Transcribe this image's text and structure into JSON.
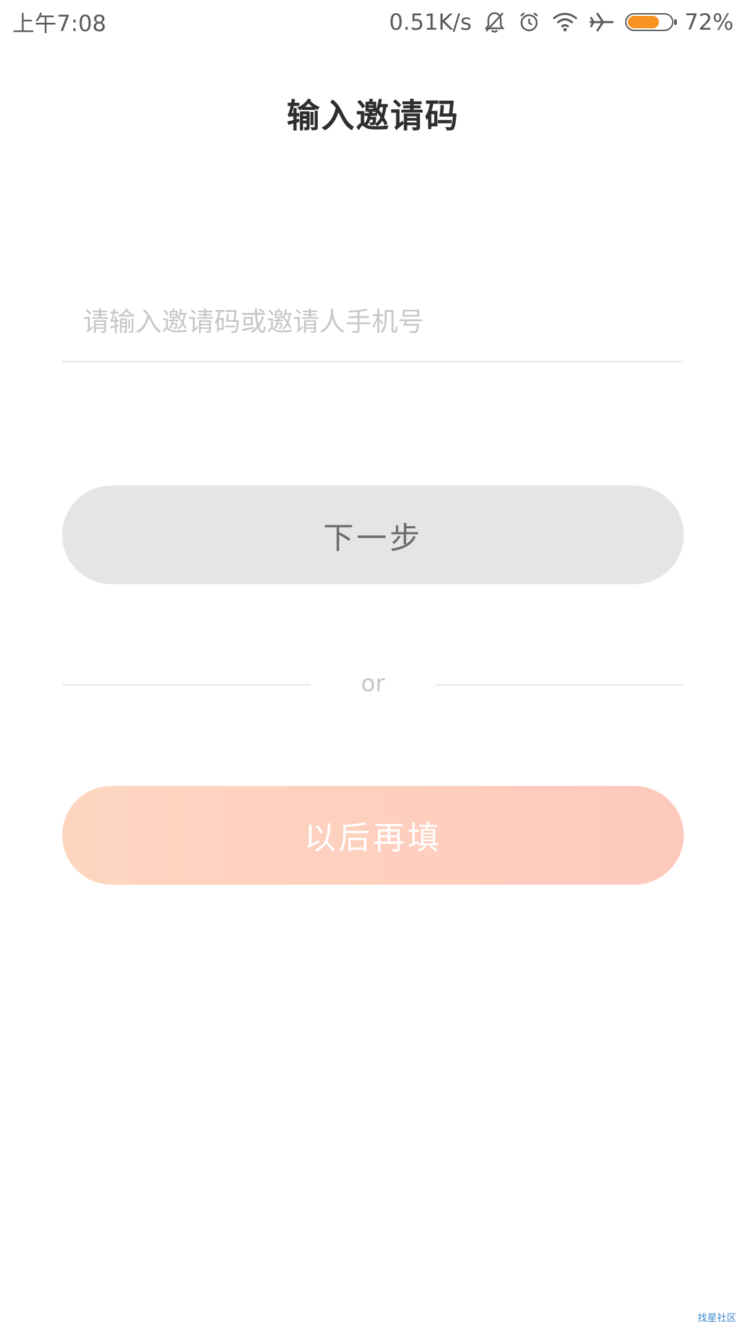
{
  "status_bar": {
    "time": "上午7:08",
    "network_speed": "0.51K/s",
    "battery_percent": "72%",
    "battery_level": 0.72,
    "icons": [
      "bell-muted-icon",
      "alarm-icon",
      "wifi-icon",
      "airplane-icon",
      "battery-icon"
    ]
  },
  "header": {
    "title": "输入邀请码"
  },
  "invite_form": {
    "input_value": "",
    "input_placeholder": "请输入邀请码或邀请人手机号",
    "next_label": "下一步",
    "divider_text": "or",
    "later_label": "以后再填"
  },
  "colors": {
    "battery_fill": "#f7931e",
    "next_button_bg": "#e5e5e5",
    "later_gradient_start": "#fed6c0",
    "later_gradient_end": "#fec9bd"
  },
  "watermark": "找星社区"
}
